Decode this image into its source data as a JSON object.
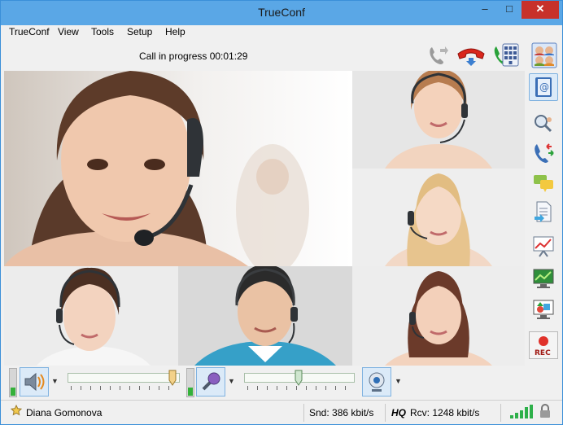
{
  "window": {
    "title": "TrueConf"
  },
  "window_controls": {
    "minimize": "–",
    "maximize": "□",
    "close": "✕"
  },
  "menu": [
    "TrueConf",
    "View",
    "Tools",
    "Setup",
    "Help"
  ],
  "toolbar": {
    "call_status": "Call in progress 00:01:29",
    "icons": [
      "transfer-call-icon",
      "hang-up-icon",
      "dial-pad-icon",
      "contacts-icon"
    ]
  },
  "video": {
    "participants": [
      {
        "role": "main-speaker"
      },
      {
        "role": "participant"
      },
      {
        "role": "participant"
      },
      {
        "role": "participant"
      },
      {
        "role": "participant"
      },
      {
        "role": "participant"
      }
    ]
  },
  "sidebar": {
    "items": [
      {
        "icon": "address-book-icon",
        "active": true
      },
      {
        "icon": "search-user-icon",
        "active": false
      },
      {
        "icon": "call-history-icon",
        "active": false
      },
      {
        "icon": "chat-icon",
        "active": false
      },
      {
        "icon": "file-transfer-icon",
        "active": false
      },
      {
        "icon": "slide-show-icon",
        "active": false
      },
      {
        "icon": "desktop-share-icon",
        "active": false
      },
      {
        "icon": "whiteboard-icon",
        "active": false
      },
      {
        "icon": "record-icon",
        "active": false,
        "label": "REC"
      }
    ]
  },
  "controls": {
    "speaker_level": 0.3,
    "speaker_volume": 0.97,
    "mic_level": 0.3,
    "mic_volume": 0.49,
    "icons": [
      "speaker-icon",
      "microphone-icon",
      "webcam-icon"
    ]
  },
  "status": {
    "user": "Diana Gomonova",
    "snd": "Snd: 386 kbit/s",
    "quality": "HQ",
    "rcv": "Rcv: 1248 kbit/s",
    "signal_bars": 5,
    "colors": {
      "signal": "#2eb04a",
      "accent": "#5aa7e6"
    }
  }
}
